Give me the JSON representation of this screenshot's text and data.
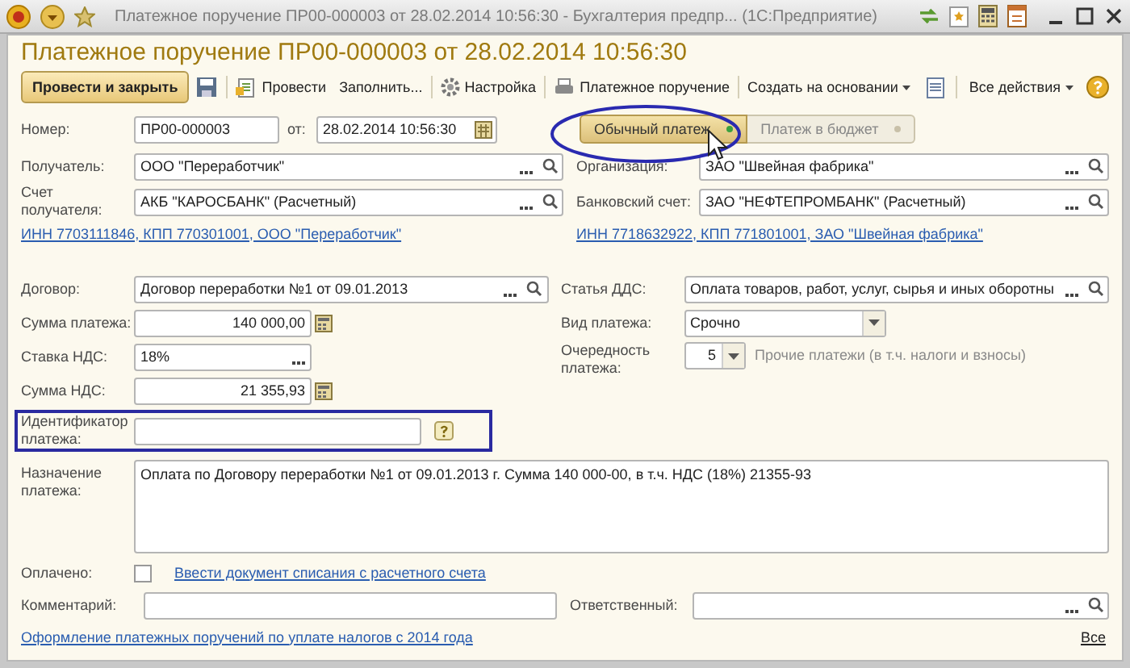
{
  "window": {
    "title": "Платежное поручение ПР00-000003 от 28.02.2014 10:56:30 - Бухгалтерия предпр... (1С:Предприятие)"
  },
  "form_title": "Платежное поручение ПР00-000003 от 28.02.2014 10:56:30",
  "toolbar": [
    {
      "kind": "primary",
      "label": "Провести и закрыть"
    },
    {
      "kind": "save"
    },
    {
      "kind": "post",
      "label": "Провести"
    },
    {
      "kind": "text",
      "label": "Заполнить..."
    },
    {
      "kind": "settings",
      "label": "Настройка"
    },
    {
      "kind": "print",
      "label": "Платежное поручение"
    },
    {
      "kind": "menu",
      "label": "Создать на основании"
    },
    {
      "kind": "report"
    },
    {
      "kind": "menu",
      "label": "Все действия"
    },
    {
      "kind": "help"
    }
  ],
  "payment_type": [
    {
      "label": "Обычный платеж",
      "selected": true
    },
    {
      "label": "Платеж в бюджет",
      "selected": false
    }
  ],
  "number": {
    "label": "Номер:",
    "value": "ПР00-000003"
  },
  "date": {
    "label": "от:",
    "value": "28.02.2014 10:56:30"
  },
  "recipient": {
    "label": "Получатель:",
    "value": "ООО \"Переработчик\""
  },
  "recipient_account": {
    "label": "Счет получателя:",
    "value": "АКБ \"КАРОСБАНК\" (Расчетный)"
  },
  "recipient_link": "ИНН 7703111846, КПП 770301001, ООО \"Переработчик\"",
  "organization": {
    "label": "Организация:",
    "value": "ЗАО \"Швейная фабрика\""
  },
  "bank_account": {
    "label": "Банковский счет:",
    "value": "ЗАО \"НЕФТЕПРОМБАНК\" (Расчетный)"
  },
  "organization_link": "ИНН 7718632922, КПП 771801001, ЗАО \"Швейная фабрика\"",
  "contract": {
    "label": "Договор:",
    "value": "Договор переработки №1 от 09.01.2013"
  },
  "payment_sum": {
    "label": "Сумма платежа:",
    "value": "140 000,00"
  },
  "vat_rate": {
    "label": "Ставка НДС:",
    "value": "18%"
  },
  "vat_sum": {
    "label": "Сумма НДС:",
    "value": "21 355,93"
  },
  "payment_id": {
    "label": "Идентификатор платежа:"
  },
  "cash_flow_item": {
    "label": "Статья ДДС:",
    "value": "Оплата товаров, работ, услуг, сырья и иных оборотны"
  },
  "payment_kind": {
    "label": "Вид платежа:",
    "value": "Срочно"
  },
  "priority": {
    "label": "Очередность платежа:",
    "value": "5",
    "note": "Прочие платежи (в т.ч. налоги и взносы)"
  },
  "purpose": {
    "label": "Назначение платежа:",
    "value": "Оплата по Договору переработки №1 от 09.01.2013 г. Сумма 140 000-00, в  т.ч. НДС  (18%) 21355-93"
  },
  "paid": {
    "label": "Оплачено:",
    "checked": false,
    "link": "Ввести документ списания с расчетного счета"
  },
  "comment": {
    "label": "Комментарий:"
  },
  "responsible": {
    "label": "Ответственный:"
  },
  "footer_link": "Оформление платежных поручений по уплате налогов с 2014 года",
  "footer_all": "Все"
}
